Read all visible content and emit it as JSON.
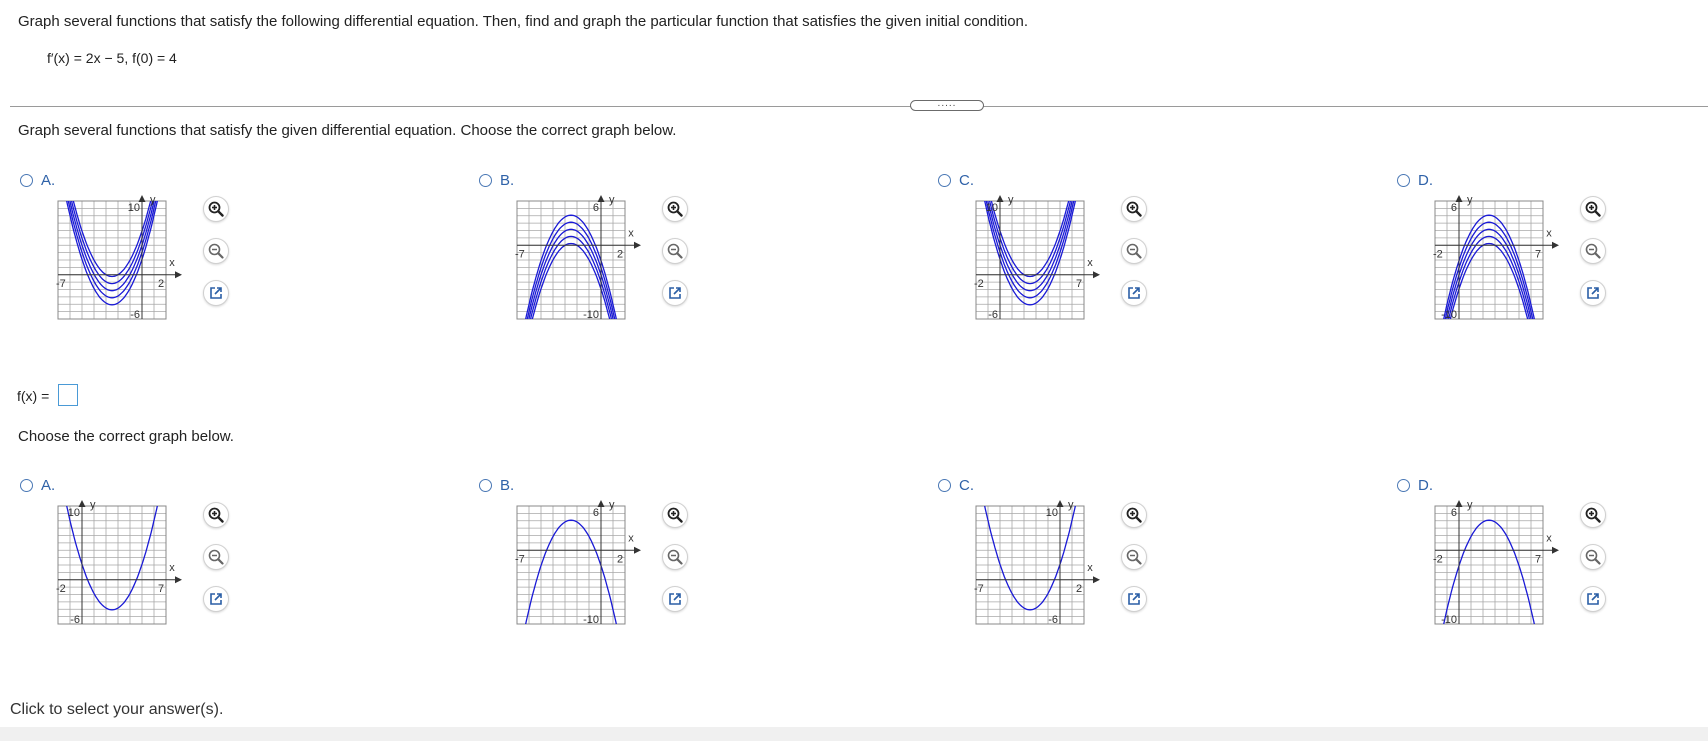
{
  "question": {
    "instruction": "Graph several functions that satisfy the following differential equation. Then, find and graph the particular function that satisfies the given initial condition.",
    "equation": "f′(x) = 2x − 5, f(0) = 4"
  },
  "part1": {
    "prompt": "Graph several functions that satisfy the given differential equation. Choose the correct graph below.",
    "choices": [
      {
        "letter": "A.",
        "type": "up",
        "xmin": "-7",
        "xmax": "2",
        "ymax": "10",
        "ymin": "-6"
      },
      {
        "letter": "B.",
        "type": "down",
        "xmin": "-7",
        "xmax": "2",
        "ymax": "6",
        "ymin": "-10"
      },
      {
        "letter": "C.",
        "type": "up",
        "xmin": "-2",
        "xmax": "7",
        "ymax": "10",
        "ymin": "-6"
      },
      {
        "letter": "D.",
        "type": "down",
        "xmin": "-2",
        "xmax": "7",
        "ymax": "6",
        "ymin": "-10"
      }
    ]
  },
  "fx": {
    "label": "f(x) ="
  },
  "part2": {
    "prompt": "Choose the correct graph below.",
    "choices": [
      {
        "letter": "A.",
        "type": "up",
        "xmin": "-2",
        "xmax": "7",
        "ymax": "10",
        "ymin": "-6"
      },
      {
        "letter": "B.",
        "type": "down",
        "xmin": "-7",
        "xmax": "2",
        "ymax": "6",
        "ymin": "-10"
      },
      {
        "letter": "C.",
        "type": "up",
        "xmin": "-7",
        "xmax": "2",
        "ymax": "10",
        "ymin": "-6"
      },
      {
        "letter": "D.",
        "type": "down",
        "xmin": "-2",
        "xmax": "7",
        "ymax": "6",
        "ymin": "-10"
      }
    ]
  },
  "axis_labels": {
    "x": "x",
    "y": "y"
  },
  "tools": [
    "zoom-in-icon",
    "zoom-out-icon",
    "open-new-window-icon"
  ],
  "colors": {
    "curve": "#1a1ad6",
    "grid": "#a8a8a8",
    "radio": "#4a78b5",
    "letter": "#2f62a8",
    "input_border": "#4a9ad6"
  },
  "status": "Click to select your answer(s)."
}
